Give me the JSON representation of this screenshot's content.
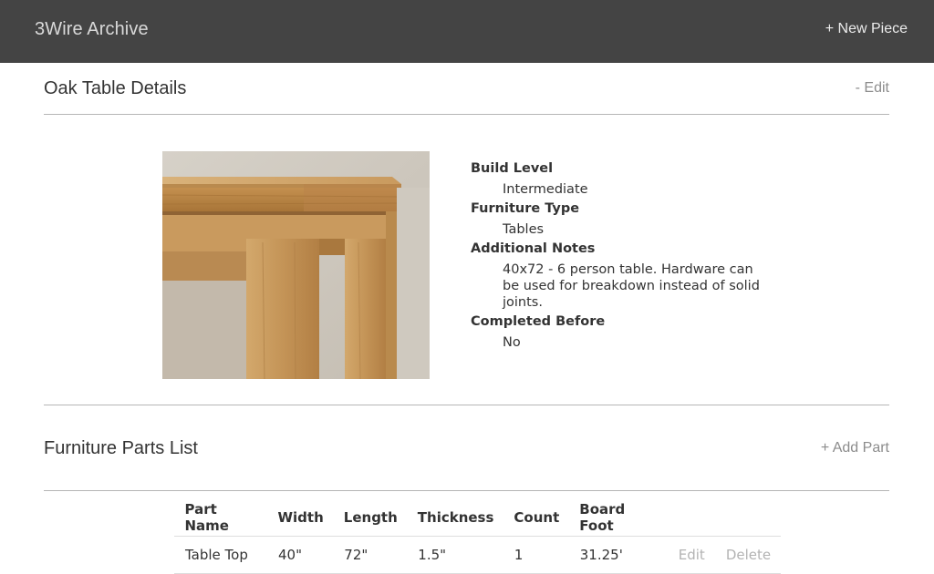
{
  "header": {
    "brand": "3Wire Archive",
    "new_piece_label": "+ New Piece"
  },
  "details_section": {
    "title": "Oak Table Details",
    "edit_label": "- Edit",
    "fields": [
      {
        "label": "Build Level",
        "value": "Intermediate"
      },
      {
        "label": "Furniture Type",
        "value": "Tables"
      },
      {
        "label": "Additional Notes",
        "value": "40x72 - 6 person table. Hardware can be used for breakdown instead of solid joints."
      },
      {
        "label": "Completed Before",
        "value": "No"
      }
    ]
  },
  "parts_section": {
    "title": "Furniture Parts List",
    "add_part_label": "+ Add Part",
    "columns": [
      "Part Name",
      "Width",
      "Length",
      "Thickness",
      "Count",
      "Board Foot"
    ],
    "rows": [
      {
        "part_name": "Table Top",
        "width": "40\"",
        "length": "72\"",
        "thickness": "1.5\"",
        "count": "1",
        "board_foot": "31.25'",
        "edit_label": "Edit",
        "delete_label": "Delete"
      }
    ]
  },
  "colors": {
    "header_bg": "#444444",
    "action_link": "#8c8c8c",
    "muted_action": "#b3b3b3"
  }
}
